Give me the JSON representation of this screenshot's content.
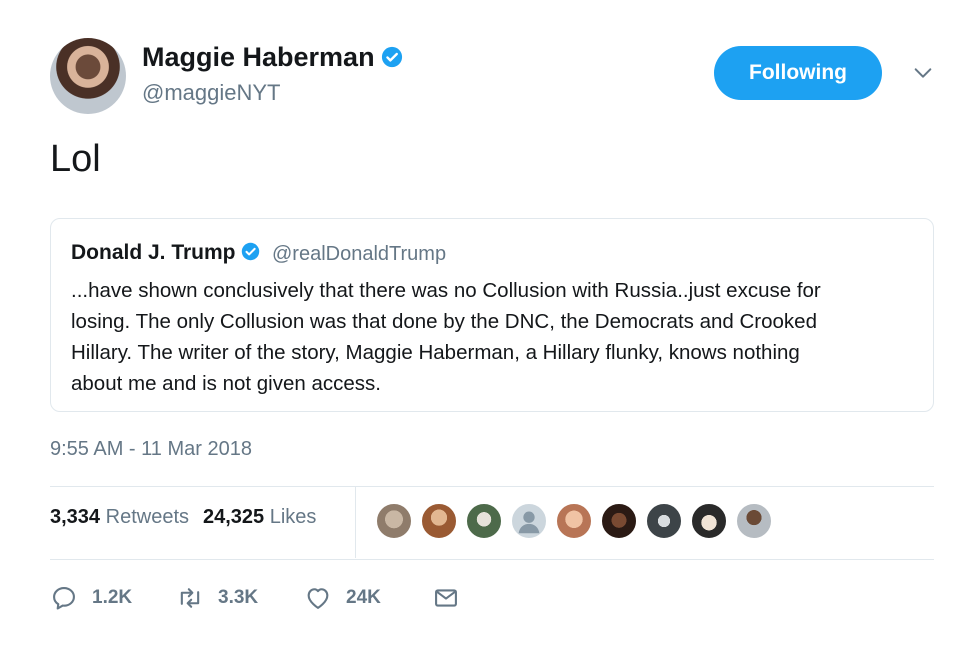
{
  "author": {
    "name": "Maggie Haberman",
    "handle": "@maggieNYT",
    "avatar_icon": "profile-photo"
  },
  "follow_button": {
    "label": "Following",
    "color": "#1da1f2"
  },
  "tweet": {
    "text": "Lol"
  },
  "quoted": {
    "name": "Donald J. Trump",
    "handle": "@realDonaldTrump",
    "lines": [
      "...have shown conclusively that there was no Collusion with Russia..just excuse for",
      "losing. The only Collusion was that done by the DNC, the Democrats and Crooked",
      "Hillary. The writer of the story, Maggie Haberman, a Hillary flunky, knows nothing",
      "about me and is not given access."
    ]
  },
  "timestamp": "9:55 AM - 11 Mar 2018",
  "stats": {
    "retweets_count": "3,334",
    "retweets_label": "Retweets",
    "likes_count": "24,325",
    "likes_label": "Likes"
  },
  "liker_avatars": [
    "avatar-1",
    "avatar-2",
    "avatar-3",
    "avatar-4",
    "avatar-5",
    "avatar-6",
    "avatar-7",
    "avatar-8",
    "avatar-9"
  ],
  "actions": {
    "reply": "1.2K",
    "retweet": "3.3K",
    "like": "24K"
  },
  "colors": {
    "text": "#14171a",
    "muted": "#657786",
    "accent": "#1da1f2",
    "border": "#e1e8ed"
  }
}
